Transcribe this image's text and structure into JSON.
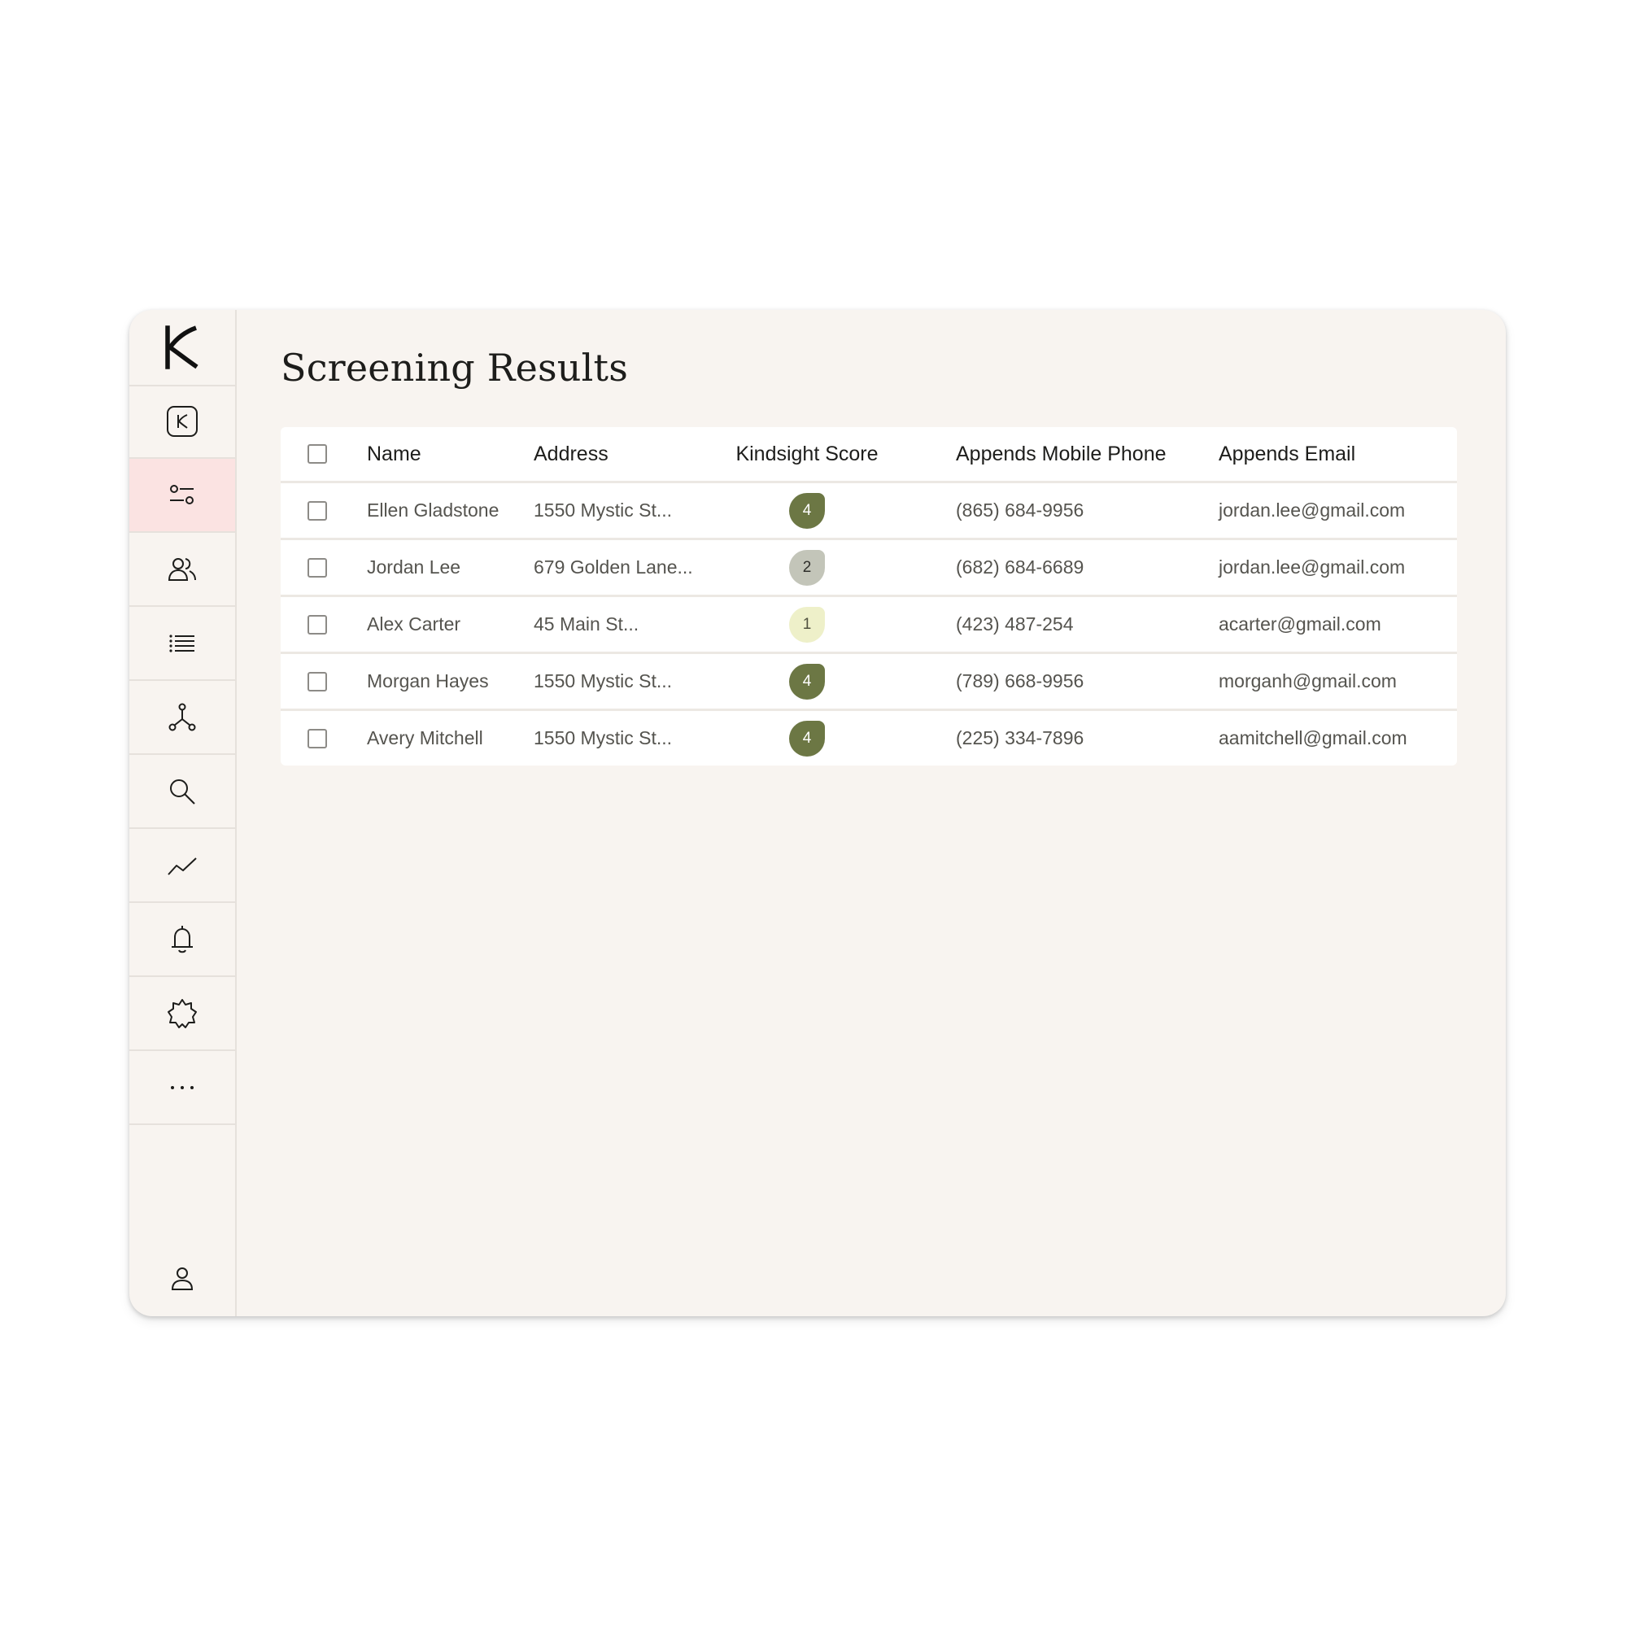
{
  "app": {
    "title": "Screening Results",
    "logo": "kindsight-logo"
  },
  "sidebar": {
    "items": [
      {
        "name": "kindsight-app",
        "icon": "k-badge-icon",
        "active": false
      },
      {
        "name": "filters",
        "icon": "sliders-icon",
        "active": true
      },
      {
        "name": "people",
        "icon": "users-icon",
        "active": false
      },
      {
        "name": "lists",
        "icon": "list-icon",
        "active": false
      },
      {
        "name": "integrations",
        "icon": "network-icon",
        "active": false
      },
      {
        "name": "search",
        "icon": "search-icon",
        "active": false
      },
      {
        "name": "analytics",
        "icon": "trend-icon",
        "active": false
      },
      {
        "name": "notifications",
        "icon": "bell-icon",
        "active": false
      },
      {
        "name": "settings",
        "icon": "gear-icon",
        "active": false
      },
      {
        "name": "more",
        "icon": "more-icon",
        "active": false
      }
    ],
    "profile_icon": "user-icon"
  },
  "table": {
    "columns": [
      "Name",
      "Address",
      "Kindsight Score",
      "Appends Mobile Phone",
      "Appends Email"
    ],
    "rows": [
      {
        "name": "Ellen Gladstone",
        "address": "1550 Mystic St...",
        "score": "4",
        "phone": "(865) 684-9956",
        "email": "jordan.lee@gmail.com"
      },
      {
        "name": "Jordan Lee",
        "address": "679 Golden Lane...",
        "score": "2",
        "phone": "(682) 684-6689",
        "email": "jordan.lee@gmail.com"
      },
      {
        "name": "Alex Carter",
        "address": "45 Main St...",
        "score": "1",
        "phone": "(423) 487-254",
        "email": "acarter@gmail.com"
      },
      {
        "name": "Morgan Hayes",
        "address": "1550 Mystic St...",
        "score": "4",
        "phone": "(789) 668-9956",
        "email": "morganh@gmail.com"
      },
      {
        "name": "Avery Mitchell",
        "address": "1550 Mystic St...",
        "score": "4",
        "phone": "(225) 334-7896",
        "email": "aamitchell@gmail.com"
      }
    ]
  },
  "colors": {
    "background": "#f8f4f0",
    "active_nav": "#fbe3e2",
    "score_high": "#6c7744",
    "score_mid": "#c3c5b9",
    "score_low": "#eef0c9"
  }
}
